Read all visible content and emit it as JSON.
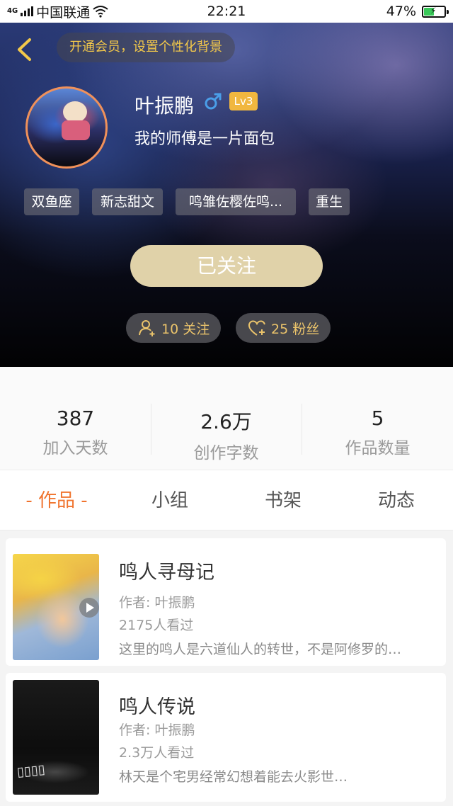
{
  "status_bar": {
    "network": "4G",
    "carrier": "中国联通",
    "time": "22:21",
    "battery_text": "47%",
    "battery_level": 0.47,
    "icons": [
      "signal-icon",
      "wifi-icon",
      "battery-icon"
    ]
  },
  "header": {
    "back_icon": "chevron-left-icon",
    "bg_tip": "开通会员，设置个性化背景",
    "username": "叶振鹏",
    "gender_icon": "male-icon",
    "level": "Lv3",
    "signature": "我的师傅是一片面包",
    "tags": [
      "双鱼座",
      "新志甜文",
      "鸣雏佐樱佐鸣...",
      "重生"
    ],
    "follow_button": "已关注",
    "following": "10 关注",
    "fans": "25 粉丝",
    "colors": {
      "tip_text": "#f3c84a",
      "avatar_ring": "#f0915a",
      "level_badge": "#f1b73f",
      "follow_button": "#e0d2a9",
      "pill_text": "#eac36b"
    }
  },
  "stats": [
    {
      "value": "387",
      "label": "加入天数"
    },
    {
      "value": "2.6万",
      "label": "创作字数"
    },
    {
      "value": "5",
      "label": "作品数量"
    }
  ],
  "tabs": [
    {
      "label": "- 作品 -",
      "active": true
    },
    {
      "label": "小组",
      "active": false
    },
    {
      "label": "书架",
      "active": false
    },
    {
      "label": "动态",
      "active": false
    }
  ],
  "accent_color": "#f0742e",
  "works": [
    {
      "title": "鸣人寻母记",
      "author": "作者: 叶振鹏",
      "views": "2175人看过",
      "desc": "这里的鸣人是六道仙人的转世，不是阿修罗的…",
      "cover_icon": "play-icon"
    },
    {
      "title": "鸣人传说",
      "author": "作者: 叶振鹏",
      "views": "2.3万人看过",
      "desc": "林天是个宅男经常幻想着能去火影世…"
    }
  ]
}
